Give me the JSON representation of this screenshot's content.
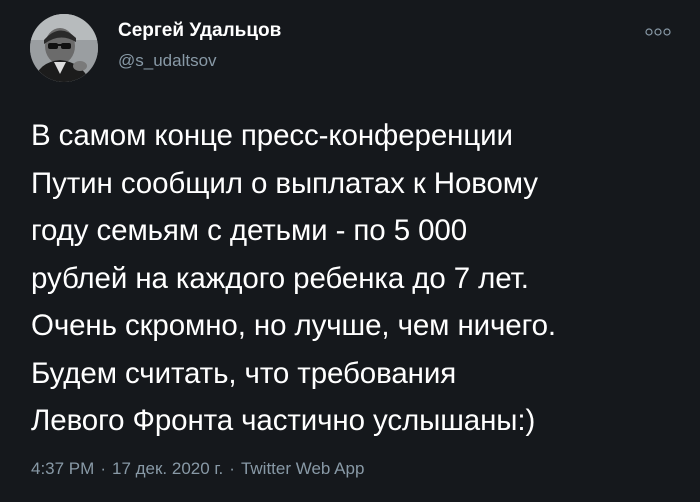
{
  "author": {
    "display_name": "Сергей Удальцов",
    "handle": "@s_udaltsov"
  },
  "tweet": {
    "text": "В самом конце пресс-конференции\nПутин сообщил о выплатах к Новому\nгоду семьям с детьми - по 5 000\nрублей на каждого ребенка до 7 лет.\nОчень скромно, но лучше, чем ничего.\nБудем считать, что требования\nЛевого Фронта частично услышаны:)"
  },
  "meta": {
    "time": "4:37 PM",
    "separator": "·",
    "date": "17 дек. 2020 г.",
    "source": "Twitter Web App"
  },
  "icons": {
    "more": "more-options-icon",
    "avatar": "avatar-photo"
  },
  "colors": {
    "background": "#15181c",
    "text_primary": "#ffffff",
    "text_secondary": "#8899a6"
  }
}
